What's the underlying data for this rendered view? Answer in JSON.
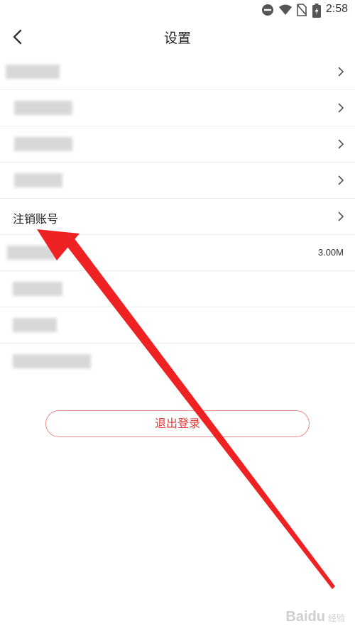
{
  "status_bar": {
    "time": "2:58",
    "icons": [
      "do-not-disturb-icon",
      "wifi-icon",
      "no-sim-icon",
      "battery-charging-icon"
    ]
  },
  "header": {
    "title": "设置",
    "back_icon": "chevron-left-icon"
  },
  "settings": {
    "items": [
      {
        "label": "",
        "obscured": true,
        "chevron": true
      },
      {
        "label": "",
        "obscured": true,
        "chevron": true
      },
      {
        "label": "",
        "obscured": true,
        "chevron": true
      },
      {
        "label": "",
        "obscured": true,
        "chevron": true
      },
      {
        "label": "注销账号",
        "obscured": false,
        "chevron": true
      },
      {
        "label": "",
        "obscured": true,
        "value": "3.00M"
      },
      {
        "label": "",
        "obscured": true
      },
      {
        "label": "",
        "obscured": true
      },
      {
        "label": "",
        "obscured": true
      }
    ]
  },
  "logout": {
    "label": "退出登录"
  },
  "annotation": {
    "color": "#ee2222"
  },
  "watermark": {
    "text": "Baidu",
    "sub": "经验"
  },
  "colors": {
    "accent_red": "#e23a3a",
    "divider": "#eeeeee"
  }
}
